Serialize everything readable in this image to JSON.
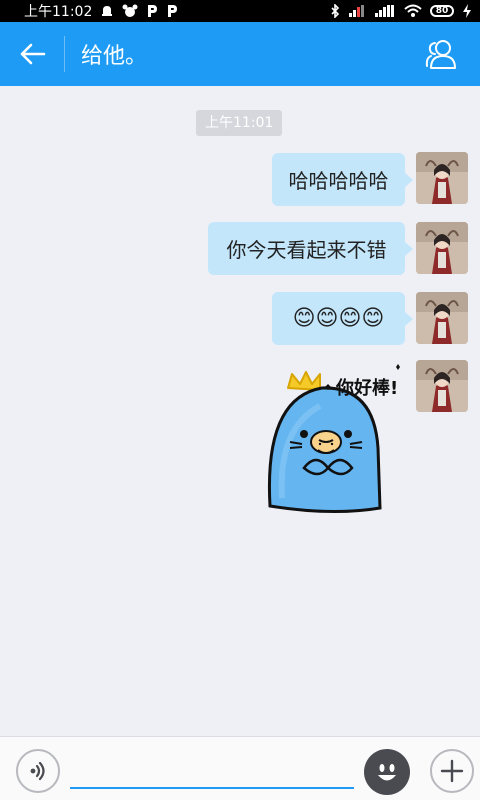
{
  "status_bar": {
    "time": "上午11:02",
    "left_icons": [
      "alarm-icon",
      "pet-icon",
      "parking-icon",
      "parking-icon"
    ],
    "right_icons": [
      "bluetooth-icon",
      "signal-icon",
      "signal-icon",
      "wifi-icon",
      "battery-icon",
      "charging-icon"
    ],
    "battery_level": "80"
  },
  "header": {
    "title": "给他。",
    "back_icon": "arrow-left-icon",
    "group_icon": "contacts-icon",
    "color": "#1e9cf5"
  },
  "chat": {
    "timestamp": "上午11:01",
    "messages": [
      {
        "type": "text",
        "text": "哈哈哈哈哈"
      },
      {
        "type": "text",
        "text": "你今天看起来不错"
      },
      {
        "type": "emoji",
        "text": "😊😊😊😊"
      },
      {
        "type": "sticker",
        "text": "你好棒!"
      }
    ]
  },
  "input_bar": {
    "voice_icon": "voice-icon",
    "emoji_icon": "smiley-icon",
    "plus_icon": "plus-icon",
    "value": ""
  }
}
